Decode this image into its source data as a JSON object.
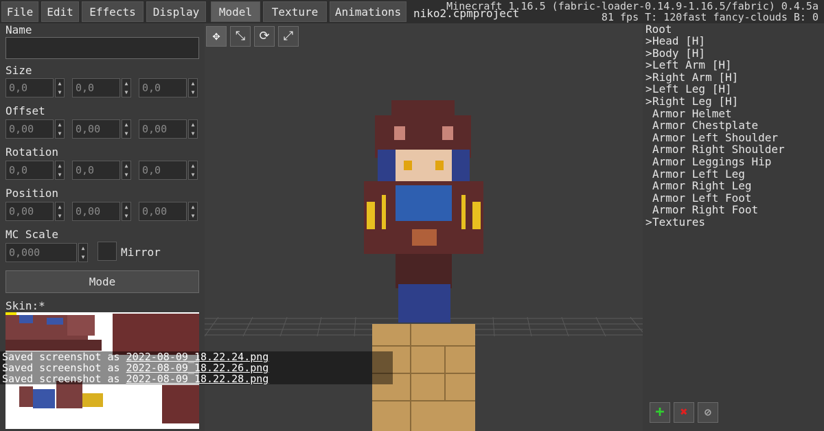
{
  "menu": {
    "items": [
      "File",
      "Edit",
      "Effects",
      "Display"
    ],
    "tabs": [
      "Model",
      "Texture",
      "Animations"
    ],
    "active_tab": "Model"
  },
  "project_name": "niko2.cpmproject",
  "mc_info": {
    "line1": "Minecraft 1.16.5 (fabric-loader-0.14.9-1.16.5/fabric) 0.4.5a",
    "line2": "81 fps T: 120fast fancy-clouds B: 0"
  },
  "properties": {
    "name_label": "Name",
    "name_value": "",
    "size_label": "Size",
    "size_values": [
      "0,0",
      "0,0",
      "0,0"
    ],
    "offset_label": "Offset",
    "offset_values": [
      "0,00",
      "0,00",
      "0,00"
    ],
    "rotation_label": "Rotation",
    "rotation_values": [
      "0,0",
      "0,0",
      "0,0"
    ],
    "position_label": "Position",
    "position_values": [
      "0,00",
      "0,00",
      "0,00"
    ],
    "mc_scale_label": "MC Scale",
    "mc_scale_value": "0,000",
    "mirror_label": "Mirror",
    "mode_label": "Mode",
    "skin_label": "Skin:*"
  },
  "tree": {
    "root": "Root",
    "items": [
      {
        "label": "Head [H]",
        "expandable": true
      },
      {
        "label": "Body [H]",
        "expandable": true
      },
      {
        "label": "Left Arm [H]",
        "expandable": true
      },
      {
        "label": "Right Arm [H]",
        "expandable": true
      },
      {
        "label": "Left Leg [H]",
        "expandable": true
      },
      {
        "label": "Right Leg [H]",
        "expandable": true
      },
      {
        "label": "Armor Helmet",
        "expandable": false
      },
      {
        "label": "Armor Chestplate",
        "expandable": false
      },
      {
        "label": "Armor Left Shoulder",
        "expandable": false
      },
      {
        "label": "Armor Right Shoulder",
        "expandable": false
      },
      {
        "label": "Armor Leggings Hip",
        "expandable": false
      },
      {
        "label": "Armor Left Leg",
        "expandable": false
      },
      {
        "label": "Armor Right Leg",
        "expandable": false
      },
      {
        "label": "Armor Left Foot",
        "expandable": false
      },
      {
        "label": "Armor Right Foot",
        "expandable": false
      },
      {
        "label": "Textures",
        "expandable": true
      }
    ]
  },
  "tree_buttons": {
    "add": "+",
    "delete": "✖"
  },
  "chat": [
    {
      "prefix": "Saved screenshot as ",
      "file": "2022-08-09_18.22.24.png"
    },
    {
      "prefix": "Saved screenshot as ",
      "file": "2022-08-09_18.22.26.png"
    },
    {
      "prefix": "Saved screenshot as ",
      "file": "2022-08-09_18.22.28.png"
    }
  ],
  "icons": {
    "move": "move-icon",
    "scale": "scale-icon",
    "rotate": "rotate-icon",
    "free": "free-transform-icon",
    "spin_up": "arrow-up-icon",
    "spin_down": "arrow-down-icon",
    "add": "plus-icon",
    "delete": "cross-icon",
    "visibility": "eye-slash-icon"
  },
  "colors": {
    "add_green": "#2fd12f",
    "delete_red": "#e02020",
    "panel_bg": "#3a3a3a",
    "viewport_bg": "#3d3d3d"
  }
}
